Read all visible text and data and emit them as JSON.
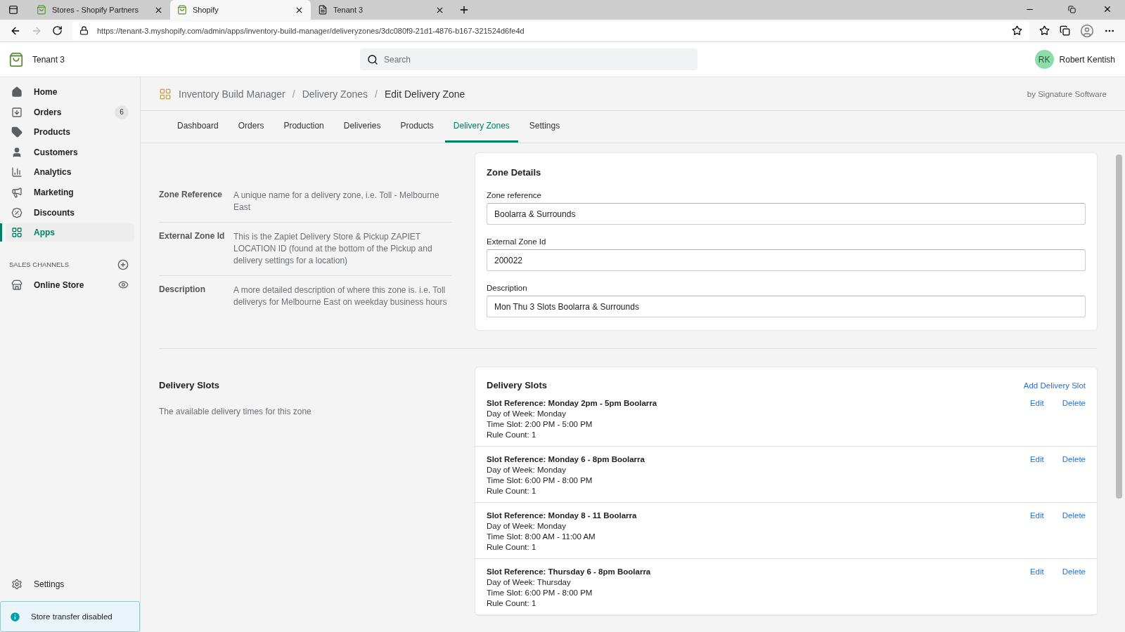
{
  "browser": {
    "tabs": [
      {
        "title": "Stores - Shopify Partners",
        "kind": "shopify",
        "selected": false
      },
      {
        "title": "Shopify",
        "kind": "shopify",
        "selected": true
      },
      {
        "title": "Tenant 3",
        "kind": "page",
        "selected": false
      }
    ],
    "url": "https://tenant-3.myshopify.com/admin/apps/inventory-build-manager/deliveryzones/3dc080f9-21d1-4876-b167-321524d6fe4d"
  },
  "topbar": {
    "store_name": "Tenant 3",
    "search": {
      "placeholder": "Search"
    },
    "user": {
      "initials": "RK",
      "name": "Robert Kentish"
    }
  },
  "sidebar": {
    "items": [
      {
        "label": "Home",
        "selected": false
      },
      {
        "label": "Orders",
        "selected": false,
        "badge": "6"
      },
      {
        "label": "Products",
        "selected": false
      },
      {
        "label": "Customers",
        "selected": false
      },
      {
        "label": "Analytics",
        "selected": false
      },
      {
        "label": "Marketing",
        "selected": false
      },
      {
        "label": "Discounts",
        "selected": false
      },
      {
        "label": "Apps",
        "selected": true
      }
    ],
    "sales_channels": {
      "heading": "SALES CHANNELS",
      "items": [
        {
          "label": "Online Store"
        }
      ]
    },
    "settings": "Settings",
    "notice": "Store transfer disabled"
  },
  "app_header": {
    "breadcrumb": [
      "Inventory Build Manager",
      "Delivery Zones",
      "Edit Delivery Zone"
    ],
    "breadcrumb_separator": "/",
    "vendor": "by Signature Software"
  },
  "nav_tabs": [
    {
      "label": "Dashboard",
      "selected": false
    },
    {
      "label": "Orders",
      "selected": false
    },
    {
      "label": "Production",
      "selected": false
    },
    {
      "label": "Deliveries",
      "selected": false
    },
    {
      "label": "Products",
      "selected": false
    },
    {
      "label": "Delivery Zones",
      "selected": true
    },
    {
      "label": "Settings",
      "selected": false
    }
  ],
  "zone_section": {
    "help": [
      {
        "label": "Zone Reference",
        "text": "A unique name for a delivery zone, i.e. Toll - Melbourne East"
      },
      {
        "label": "External Zone Id",
        "text": "This is the Zapiet Delivery Store & Pickup ZAPIET LOCATION ID (found at the bottom of the Pickup and delivery settings for a location)"
      },
      {
        "label": "Description",
        "text": "A more detailed description of where this zone is. i.e. Toll deliverys for Melbourne East on weekday business hours"
      }
    ],
    "card_title": "Zone Details",
    "fields": [
      {
        "label": "Zone reference",
        "value": "Boolarra & Surrounds"
      },
      {
        "label": "External Zone Id",
        "value": "200022"
      },
      {
        "label": "Description",
        "value": "Mon Thu 3 Slots Boolarra & Surrounds"
      }
    ]
  },
  "slots_section": {
    "title": "Delivery Slots",
    "description": "The available delivery times for this zone",
    "card_title": "Delivery Slots",
    "add_link": "Add Delivery Slot",
    "slots": [
      {
        "reference": "Slot Reference: Monday 2pm - 5pm Boolarra",
        "lines": [
          "Day of Week: Monday",
          "Time Slot: 2:00 PM - 5:00 PM",
          "Rule Count: 1"
        ],
        "edit": "Edit",
        "delete": "Delete"
      },
      {
        "reference": "Slot Reference: Monday 6 - 8pm Boolarra",
        "lines": [
          "Day of Week: Monday",
          "Time Slot: 6:00 PM - 8:00 PM",
          "Rule Count: 1"
        ],
        "edit": "Edit",
        "delete": "Delete"
      },
      {
        "reference": "Slot Reference: Monday 8 - 11 Boolarra",
        "lines": [
          "Day of Week: Monday",
          "Time Slot: 8:00 AM - 11:00 AM",
          "Rule Count: 1"
        ],
        "edit": "Edit",
        "delete": "Delete"
      },
      {
        "reference": "Slot Reference: Thursday 6 - 8pm Boolarra",
        "lines": [
          "Day of Week: Thursday",
          "Time Slot: 6:00 PM - 8:00 PM",
          "Rule Count: 1"
        ],
        "edit": "Edit",
        "delete": "Delete"
      }
    ]
  }
}
